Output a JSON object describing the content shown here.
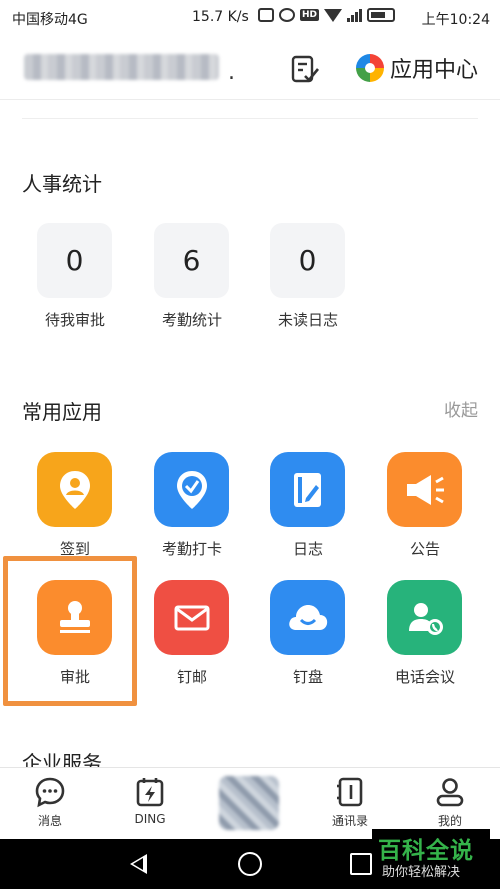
{
  "status_bar": {
    "carrier": "中国移动4G",
    "speed": "15.7 K/s",
    "hd": "HD",
    "time": "上午10:24"
  },
  "header": {
    "org_name": "",
    "org_suffix": ".",
    "app_center_label": "应用中心"
  },
  "hr_stats": {
    "title": "人事统计",
    "items": [
      {
        "value": "0",
        "label": "待我审批"
      },
      {
        "value": "6",
        "label": "考勤统计"
      },
      {
        "value": "0",
        "label": "未读日志"
      }
    ]
  },
  "common_apps": {
    "title": "常用应用",
    "collapse_label": "收起",
    "apps": [
      {
        "label": "签到",
        "icon": "location-pin-icon",
        "color": "#f7a51b"
      },
      {
        "label": "考勤打卡",
        "icon": "location-check-icon",
        "color": "#2f8cf0"
      },
      {
        "label": "日志",
        "icon": "notebook-pen-icon",
        "color": "#2f8cf0"
      },
      {
        "label": "公告",
        "icon": "megaphone-icon",
        "color": "#fb8c2d"
      },
      {
        "label": "审批",
        "icon": "stamp-icon",
        "color": "#fb8c2d"
      },
      {
        "label": "钉邮",
        "icon": "envelope-icon",
        "color": "#ef4f43"
      },
      {
        "label": "钉盘",
        "icon": "cloud-icon",
        "color": "#2f8cf0"
      },
      {
        "label": "电话会议",
        "icon": "phone-contact-icon",
        "color": "#27b37b"
      }
    ]
  },
  "enterprise_services": {
    "title": "企业服务"
  },
  "bottom_nav": {
    "items": [
      {
        "label": "消息",
        "icon": "chat-bubble-icon"
      },
      {
        "label": "DING",
        "icon": "ding-lightning-icon"
      },
      {
        "label": "",
        "icon": "workbench-icon"
      },
      {
        "label": "通讯录",
        "icon": "contacts-book-icon"
      },
      {
        "label": "我的",
        "icon": "profile-icon"
      }
    ]
  },
  "watermark": {
    "title": "百科全说",
    "subtitle": "助你轻松解决"
  },
  "colors": {
    "highlight": "#f0913f",
    "blue": "#2f8cf0",
    "orange": "#fb8c2d",
    "yellow": "#f7a51b",
    "red": "#ef4f43",
    "green": "#27b37b"
  }
}
